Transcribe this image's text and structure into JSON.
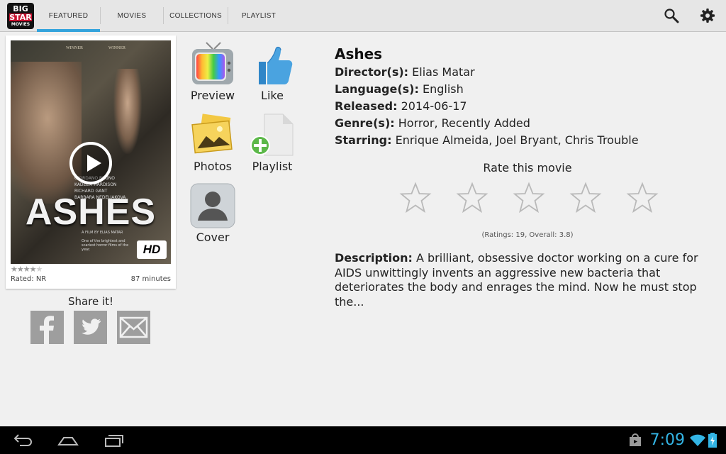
{
  "app": {
    "logo": {
      "line1": "BIG",
      "line2": "STAR",
      "line3": "MOVIES"
    }
  },
  "tabs": [
    {
      "label": "FEATURED",
      "active": true
    },
    {
      "label": "MOVIES",
      "active": false
    },
    {
      "label": "COLLECTIONS",
      "active": false
    },
    {
      "label": "PLAYLIST",
      "active": false
    }
  ],
  "actions": {
    "search_icon": "search-icon",
    "settings_icon": "gear-icon"
  },
  "poster": {
    "title_art": "ASHES",
    "hd_badge": "HD",
    "laurel_left": "WINNER",
    "laurel_right": "WINNER",
    "credits": [
      "GIORDANO BRUNO",
      "KADEEM HARDISON",
      "RICHARD GANT",
      "BARBARA NEDELJAKOVA"
    ],
    "director_credit": "A FILM BY ELIAS MATAR",
    "quote": "One of the brightest and scariest horror films of the year.",
    "star_rating": 4,
    "star_max": 5,
    "rated": "Rated: NR",
    "duration": "87 minutes"
  },
  "share": {
    "label": "Share it!",
    "networks": [
      "facebook-icon",
      "twitter-icon",
      "email-icon"
    ]
  },
  "tiles": {
    "preview": "Preview",
    "like": "Like",
    "photos": "Photos",
    "playlist": "Playlist",
    "cover": "Cover"
  },
  "movie": {
    "title": "Ashes",
    "director_label": "Director(s):",
    "director": "Elias Matar",
    "language_label": "Language(s):",
    "language": "English",
    "released_label": "Released:",
    "released": "2014-06-17",
    "genre_label": "Genre(s):",
    "genre": "Horror, Recently Added",
    "starring_label": "Starring:",
    "starring": "Enrique Almeida, Joel Bryant, Chris Trouble"
  },
  "rating": {
    "prompt": "Rate this movie",
    "stars_selected": 0,
    "stars_max": 5,
    "summary": "(Ratings: 19, Overall: 3.8)"
  },
  "description": {
    "label": "Description:",
    "text": "A brilliant, obsessive doctor working on a cure for AIDS unwittingly invents an aggressive new bacteria that deteriorates the body and enrages the mind. Now he must stop the..."
  },
  "system": {
    "time": "7:09"
  },
  "colors": {
    "accent": "#33a3dc",
    "clock": "#33b5e5",
    "share_icons": "#9e9e9e"
  }
}
